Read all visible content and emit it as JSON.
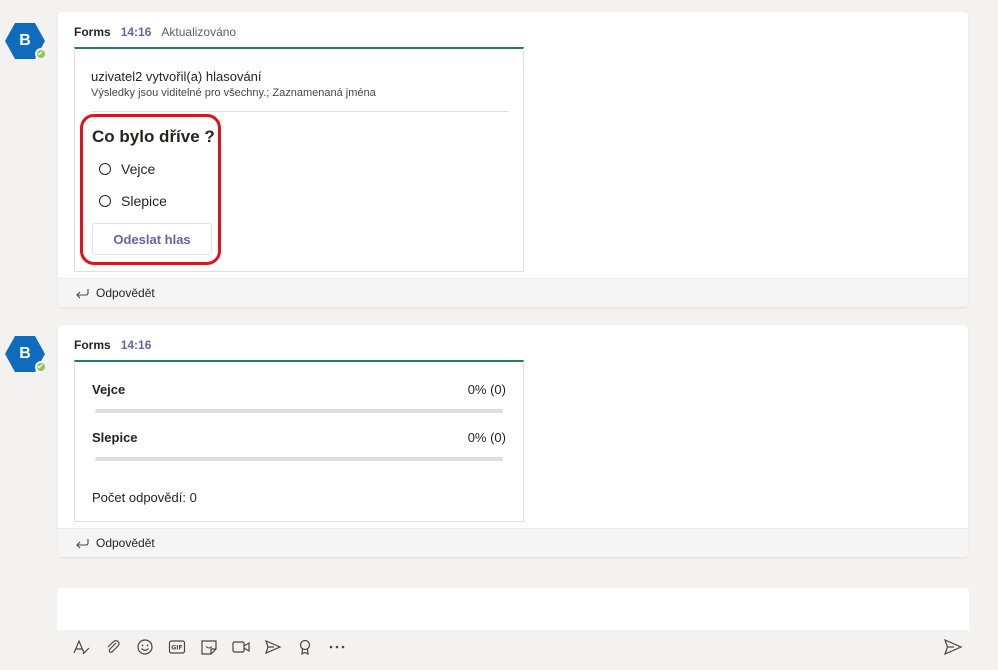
{
  "messages": [
    {
      "avatar_letter": "B",
      "sender": "Forms",
      "time": "14:16",
      "status": "Aktualizováno",
      "poll": {
        "creator_line": "uzivatel2 vytvořil(a) hlasování",
        "meta_line": "Výsledky jsou viditelné pro všechny.; Zaznamenaná jména",
        "question": "Co bylo dříve ?",
        "options": [
          "Vejce",
          "Slepice"
        ],
        "submit_label": "Odeslat hlas"
      },
      "reply_label": "Odpovědět"
    },
    {
      "avatar_letter": "B",
      "sender": "Forms",
      "time": "14:16",
      "results": [
        {
          "option": "Vejce",
          "percent_text": "0% (0)",
          "fraction": 0
        },
        {
          "option": "Slepice",
          "percent_text": "0% (0)",
          "fraction": 0
        }
      ],
      "response_count": "Počet odpovědí: 0",
      "reply_label": "Odpovědět"
    }
  ],
  "composer": {
    "toolbar_icons": [
      "format-icon",
      "attach-icon",
      "emoji-icon",
      "gif-icon",
      "sticker-icon",
      "meet-now-icon",
      "delivery-options-icon",
      "praise-icon",
      "more-options-icon"
    ],
    "send_icon": "send-icon"
  },
  "colors": {
    "accent": "#6264a7",
    "card_top": "#237b75",
    "avatar": "#0f6cbd",
    "presence": "#92c353",
    "highlight": "#e3101c"
  }
}
